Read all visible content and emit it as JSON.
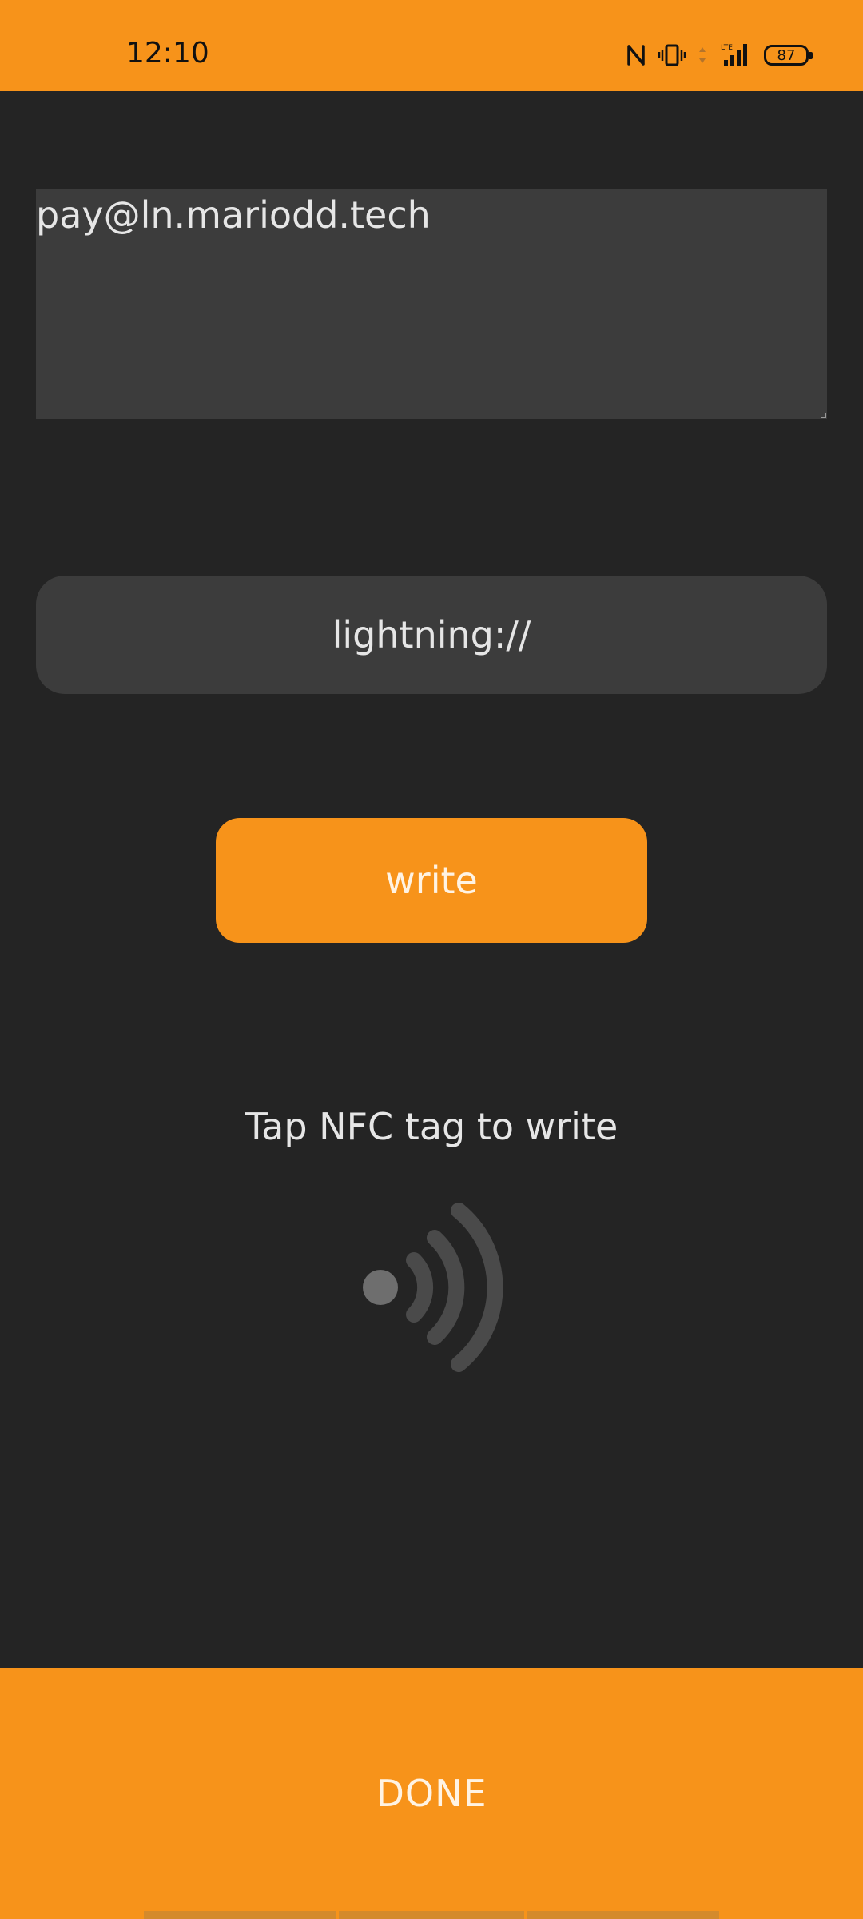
{
  "status_bar": {
    "time": "12:10",
    "battery_level": "87",
    "icons": [
      "nfc-icon",
      "vibrate-icon",
      "data-arrows-icon",
      "lte-signal-icon",
      "battery-icon"
    ],
    "background_color": "#f7931a"
  },
  "address_field": {
    "value": "pay@ln.mariodd.tech"
  },
  "prefix_selector": {
    "label": "lightning://"
  },
  "write_button": {
    "label": "write"
  },
  "nfc": {
    "prompt": "Tap NFC tag to write",
    "icon": "nfc-waves-icon"
  },
  "done_button": {
    "label": "DONE"
  },
  "colors": {
    "accent": "#f7931a",
    "background": "#242424",
    "field": "#3c3c3c",
    "text": "#e6e6e6"
  }
}
